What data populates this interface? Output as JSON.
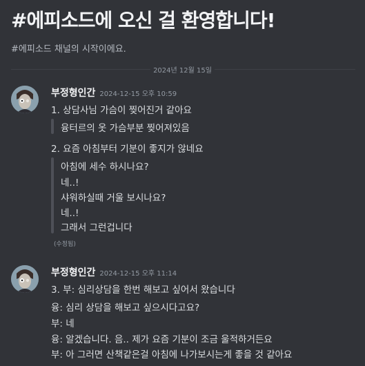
{
  "welcome": {
    "title": "#에피소드에 오신 걸 환영합니다!",
    "subtitle": "#에피소드 채널의 시작이에요."
  },
  "date_divider": "2024년 12월 15일",
  "messages": [
    {
      "username": "부정형인간",
      "timestamp": "2024-12-15 오후 10:59",
      "items": [
        "1. 상담사님 가슴이 찢어진거 같아요",
        "융터르의 옷 가슴부분 찢어져있음",
        "2. 요즘 아침부터 기분이 좋지가 않네요",
        "아침에 세수 하시나요?",
        "네..!",
        "샤워하실때 거울 보시나요?",
        "네..!",
        "그래서 그런겁니다"
      ],
      "edited": "(수정됨)"
    },
    {
      "username": "부정형인간",
      "timestamp": "2024-12-15 오후 11:14",
      "items": [
        "3. 부: 심리상담을 한번 해보고 싶어서 왔습니다",
        "융: 심리 상담을 해보고 싶으시다고요?",
        "부: 네",
        "융: 알겠습니다. 음.. 제가 요즘 기분이 조금 울적하거든요",
        "부: 아 그러면 산책같은걸 아침에 나가보시는게 좋을 것 같아요"
      ]
    }
  ],
  "colors": {
    "background": "#313338",
    "username": "#f2f3f5",
    "text": "#dbdee1",
    "muted": "#949ba4",
    "quote_bar": "#4e5058"
  }
}
